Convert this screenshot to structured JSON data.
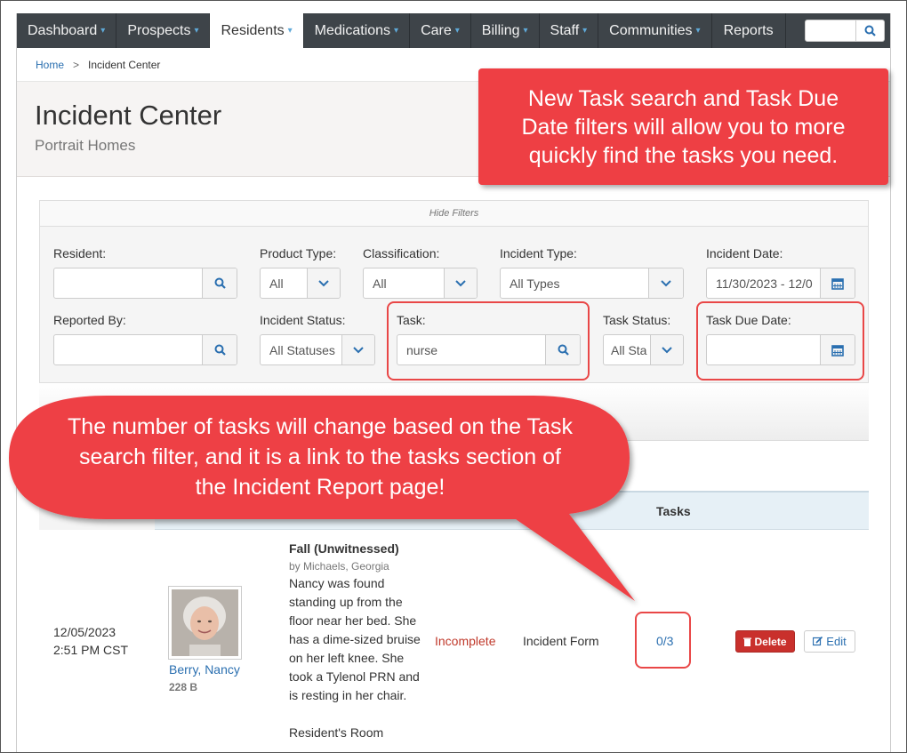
{
  "nav": {
    "items": [
      {
        "label": "Dashboard",
        "dropdown": true
      },
      {
        "label": "Prospects",
        "dropdown": true
      },
      {
        "label": "Residents",
        "dropdown": true,
        "active": true
      },
      {
        "label": "Medications",
        "dropdown": true
      },
      {
        "label": "Care",
        "dropdown": true
      },
      {
        "label": "Billing",
        "dropdown": true
      },
      {
        "label": "Staff",
        "dropdown": true
      },
      {
        "label": "Communities",
        "dropdown": true
      },
      {
        "label": "Reports",
        "dropdown": false
      }
    ],
    "caret": "⌄"
  },
  "breadcrumb": {
    "home": "Home",
    "separator": ">",
    "current": "Incident Center"
  },
  "header": {
    "title": "Incident Center",
    "subtitle": "Portrait Homes"
  },
  "filters": {
    "toggle_label": "Hide Filters",
    "resident": {
      "label": "Resident:",
      "value": ""
    },
    "product_type": {
      "label": "Product Type:",
      "value": "All"
    },
    "classification": {
      "label": "Classification:",
      "value": "All"
    },
    "incident_type": {
      "label": "Incident Type:",
      "value": "All Types"
    },
    "incident_date": {
      "label": "Incident Date:",
      "value": "11/30/2023 - 12/0"
    },
    "reported_by": {
      "label": "Reported By:",
      "value": ""
    },
    "incident_status": {
      "label": "Incident Status:",
      "value": "All Statuses"
    },
    "task": {
      "label": "Task:",
      "value": "nurse"
    },
    "task_status": {
      "label": "Task Status:",
      "value": "All Sta"
    },
    "task_due_date": {
      "label": "Task Due Date:",
      "value": ""
    }
  },
  "table": {
    "tasks_header": "Tasks"
  },
  "row": {
    "date": "12/05/2023",
    "time": "2:51 PM CST",
    "resident_name": "Berry, Nancy",
    "room": "228 B",
    "incident_title": "Fall (Unwitnessed)",
    "reported_by": "by Michaels, Georgia",
    "description": "Nancy was found standing up from the floor near her bed. She has a dime-sized bruise on her left knee. She took a Tylenol PRN and is resting in her chair.",
    "location": "Resident's Room",
    "status": "Incomplete",
    "form": "Incident Form",
    "tasks_count": "0/3",
    "delete_label": "Delete",
    "edit_label": "Edit"
  },
  "callouts": {
    "top": "New Task search and Task Due Date filters will allow you to more quickly find the tasks you need.",
    "bottom": "The number of tasks will change based on the Task search filter, and it is a link to the tasks section of the Incident Report page!"
  },
  "colors": {
    "nav_bg": "#3e4449",
    "accent_blue": "#2a6fb0",
    "callout_red": "#ee3f44",
    "status_red": "#c0392b",
    "delete_red": "#c9302c"
  }
}
